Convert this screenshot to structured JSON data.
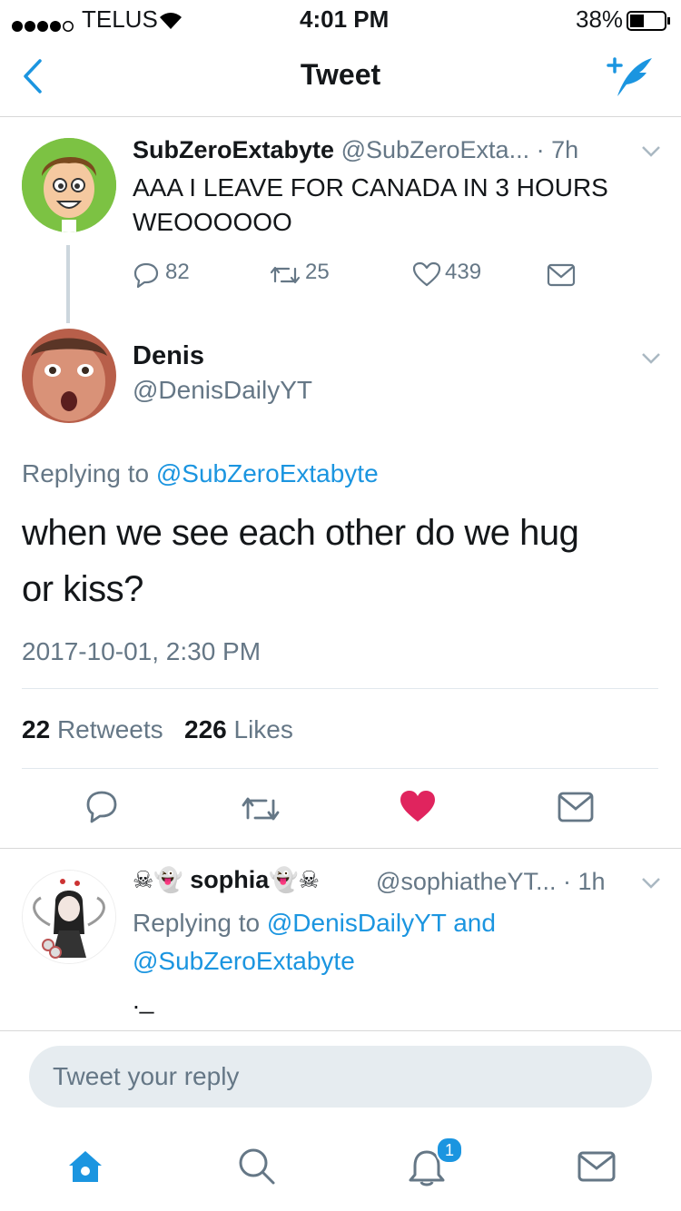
{
  "status_bar": {
    "carrier": "TELUS",
    "time": "4:01 PM",
    "battery": "38%"
  },
  "nav": {
    "title": "Tweet",
    "back_icon": "chevron-left-icon",
    "compose_icon": "compose-tweet-icon"
  },
  "parent_tweet": {
    "name": "SubZeroExtabyte",
    "handle": "@SubZeroExta...",
    "age": "· 7h",
    "text_line1": "AAA I LEAVE FOR CANADA IN 3 HOURS",
    "text_line2": "WEOOOOOO",
    "replies": "82",
    "retweets": "25",
    "likes": "439"
  },
  "main_tweet": {
    "name": "Denis",
    "handle": "@DenisDailyYT",
    "replying_prefix": "Replying to",
    "replying_to": "@SubZeroExtabyte",
    "text_line1": "when we see each other do we hug",
    "text_line2": "or kiss?",
    "timestamp": "2017-10-01, 2:30 PM",
    "retweets_count": "22",
    "retweets_label": "Retweets",
    "likes_count": "226",
    "likes_label": "Likes"
  },
  "reply_tweet": {
    "name": "sophia",
    "handle": "@sophiatheYT...",
    "age": "· 1h",
    "replying_prefix": "Replying to",
    "replying_to_1": "@DenisDailyYT",
    "replying_and": "and",
    "replying_to_2": "@SubZeroExtabyte",
    "text": "._"
  },
  "reply_box": {
    "placeholder": "Tweet your reply"
  },
  "tab_bar": {
    "notifications_badge": "1"
  },
  "colors": {
    "accent": "#1b95e0",
    "like": "#e0245e",
    "muted": "#657786"
  }
}
